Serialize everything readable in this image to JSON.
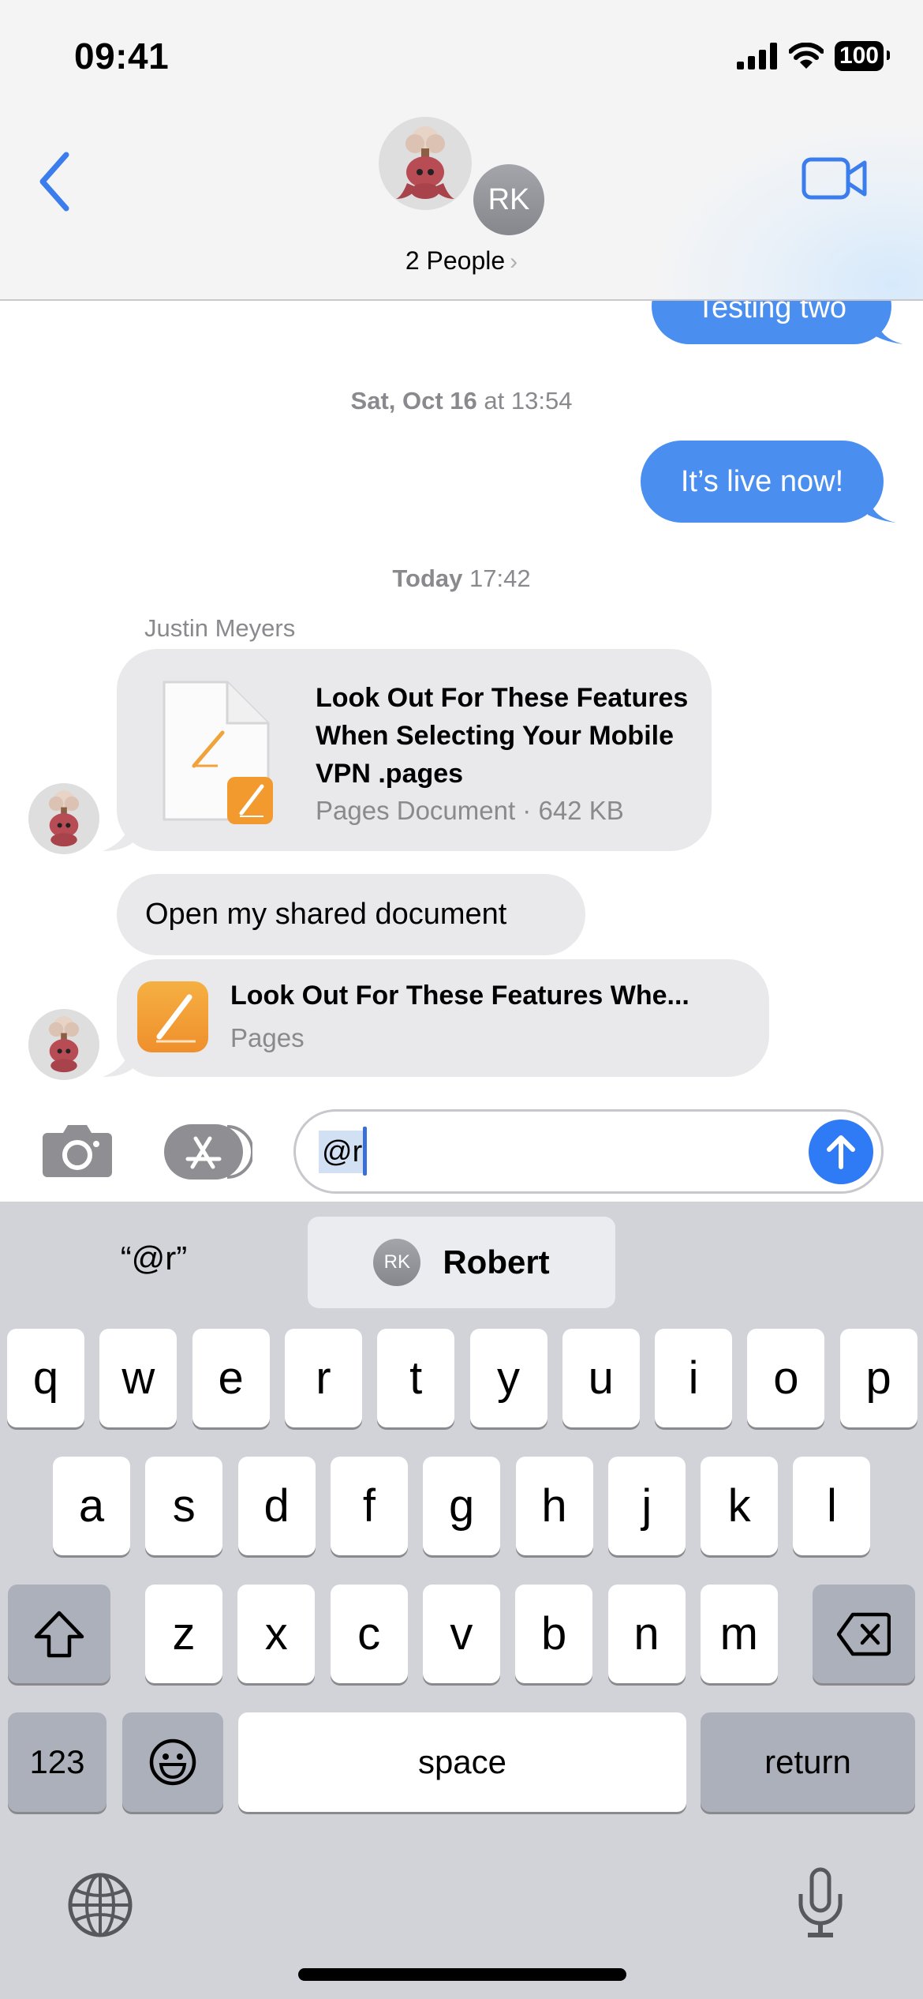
{
  "status_bar": {
    "time": "09:41",
    "battery": "100"
  },
  "header": {
    "participants_label": "2 People",
    "second_avatar_initials": "RK"
  },
  "messages": {
    "partial_outgoing": "Testing two",
    "timestamp_1": {
      "day": "Sat, Oct 16",
      "time": "at 13:54"
    },
    "outgoing_1": "It’s live now!",
    "timestamp_2": {
      "day": "Today",
      "time": "17:42"
    },
    "sender_name": "Justin Meyers",
    "document": {
      "title": "Look Out For These Features When Selecting Your Mobile VPN .pages",
      "subtitle": "Pages Document · 642 KB"
    },
    "incoming_text": "Open my shared document",
    "link": {
      "title": "Look Out For These Features Whe...",
      "subtitle": "Pages"
    }
  },
  "composer": {
    "value": "@r"
  },
  "colors": {
    "accent_blue": "#4a8ff0",
    "send_blue": "#2f7af5",
    "incoming_bubble": "#e9e9eb",
    "pages_orange": "#f2a33a"
  },
  "suggestions": {
    "literal": "“@r”",
    "mention_initials": "RK",
    "mention_name": "Robert"
  },
  "keyboard": {
    "row1": [
      "q",
      "w",
      "e",
      "r",
      "t",
      "y",
      "u",
      "i",
      "o",
      "p"
    ],
    "row2": [
      "a",
      "s",
      "d",
      "f",
      "g",
      "h",
      "j",
      "k",
      "l"
    ],
    "row3": [
      "z",
      "x",
      "c",
      "v",
      "b",
      "n",
      "m"
    ],
    "numbers_label": "123",
    "space_label": "space",
    "return_label": "return"
  }
}
